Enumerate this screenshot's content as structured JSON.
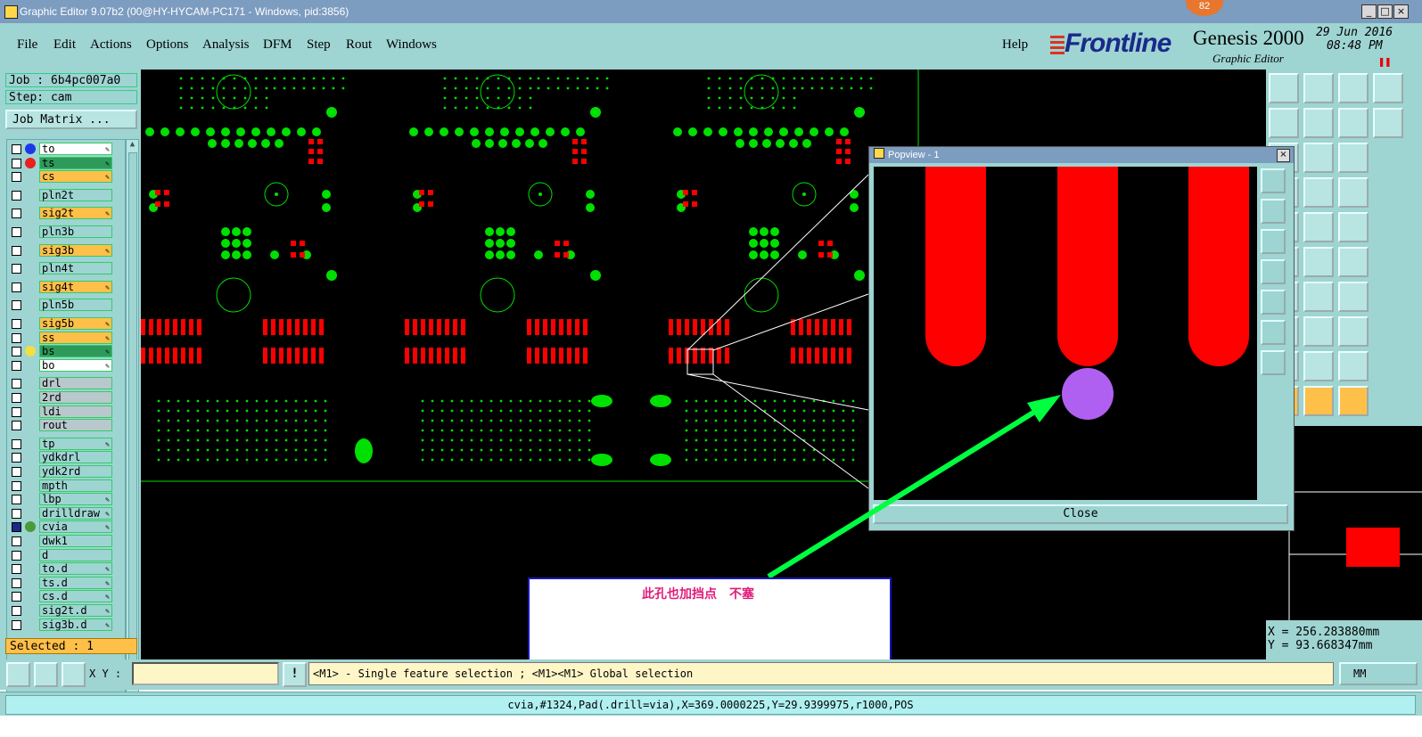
{
  "window": {
    "title": "Graphic Editor 9.07b2 (00@HY-HYCAM-PC171 - Windows, pid:3856)",
    "notification_count": "82",
    "minimize": "_",
    "maximize": "□",
    "close": "×"
  },
  "menu": {
    "items": [
      "File",
      "Edit",
      "Actions",
      "Options",
      "Analysis",
      "DFM",
      "Step",
      "Rout",
      "Windows"
    ],
    "help": "Help"
  },
  "brand": {
    "logo": "Frontline",
    "product": "Genesis 2000",
    "subtitle": "Graphic Editor",
    "date": "29 Jun 2016",
    "time": "08:48 PM"
  },
  "job": {
    "job_line": "Job : 6b4pc007a0",
    "step_line": "Step: cam",
    "matrix_button": "Job Matrix ..."
  },
  "layers": [
    {
      "name": "to",
      "bg": "#ffffff",
      "dot": "#1a3ae8",
      "edit": true
    },
    {
      "name": "ts",
      "bg": "#2e9a5a",
      "dot": "#e82020",
      "edit": true
    },
    {
      "name": "cs",
      "bg": "#ffc04a",
      "dot": "",
      "edit": true
    },
    {
      "name": "pln2t",
      "bg": "#9ed4d2",
      "dot": "",
      "edit": false
    },
    {
      "name": "sig2t",
      "bg": "#ffc04a",
      "dot": "",
      "edit": true
    },
    {
      "name": "pln3b",
      "bg": "#9ed4d2",
      "dot": "",
      "edit": false
    },
    {
      "name": "sig3b",
      "bg": "#ffc04a",
      "dot": "",
      "edit": true
    },
    {
      "name": "pln4t",
      "bg": "#9ed4d2",
      "dot": "",
      "edit": false
    },
    {
      "name": "sig4t",
      "bg": "#ffc04a",
      "dot": "",
      "edit": true
    },
    {
      "name": "pln5b",
      "bg": "#9ed4d2",
      "dot": "",
      "edit": false
    },
    {
      "name": "sig5b",
      "bg": "#ffc04a",
      "dot": "",
      "edit": true
    },
    {
      "name": "ss",
      "bg": "#ffc04a",
      "dot": "",
      "edit": true
    },
    {
      "name": "bs",
      "bg": "#2e9a5a",
      "dot": "#f0e040",
      "edit": true
    },
    {
      "name": "bo",
      "bg": "#ffffff",
      "dot": "",
      "edit": true
    },
    {
      "name": "drl",
      "bg": "#b8c8cc",
      "dot": "",
      "edit": false
    },
    {
      "name": "2rd",
      "bg": "#b8c8cc",
      "dot": "",
      "edit": false
    },
    {
      "name": "ldi",
      "bg": "#b8c8cc",
      "dot": "",
      "edit": false
    },
    {
      "name": "rout",
      "bg": "#b8c8cc",
      "dot": "",
      "edit": false
    },
    {
      "name": "tp",
      "bg": "#9ed4d2",
      "dot": "",
      "edit": true
    },
    {
      "name": "ydkdrl",
      "bg": "#9ed4d2",
      "dot": "",
      "edit": false
    },
    {
      "name": "ydk2rd",
      "bg": "#9ed4d2",
      "dot": "",
      "edit": false
    },
    {
      "name": "mpth",
      "bg": "#9ed4d2",
      "dot": "",
      "edit": false
    },
    {
      "name": "lbp",
      "bg": "#9ed4d2",
      "dot": "",
      "edit": true
    },
    {
      "name": "drilldraw",
      "bg": "#9ed4d2",
      "dot": "",
      "edit": true
    },
    {
      "name": "cvia",
      "bg": "#9ed4d2",
      "dot": "#4a9a3a",
      "edit": true
    },
    {
      "name": "dwk1",
      "bg": "#9ed4d2",
      "dot": "",
      "edit": false
    },
    {
      "name": "d",
      "bg": "#9ed4d2",
      "dot": "",
      "edit": false
    },
    {
      "name": "to.d",
      "bg": "#9ed4d2",
      "dot": "",
      "edit": true
    },
    {
      "name": "ts.d",
      "bg": "#9ed4d2",
      "dot": "",
      "edit": true
    },
    {
      "name": "cs.d",
      "bg": "#9ed4d2",
      "dot": "",
      "edit": true
    },
    {
      "name": "sig2t.d",
      "bg": "#9ed4d2",
      "dot": "",
      "edit": true
    },
    {
      "name": "sig3b.d",
      "bg": "#9ed4d2",
      "dot": "",
      "edit": true
    }
  ],
  "selected": "Selected : 1",
  "popview": {
    "title": "Popview - 1",
    "close_button": "Close",
    "close_x": "×"
  },
  "annotation": {
    "text": "此孔也加挡点　不塞"
  },
  "coords": {
    "x": "X = 256.283880mm",
    "y": "Y = 93.668347mm"
  },
  "bottom": {
    "xy_label": "X Y :",
    "xy_value": "",
    "message": "<M1> - Single feature selection ; <M1><M1> Global selection",
    "units": "MM",
    "bang": "!"
  },
  "status": "cvia,#1324,Pad(.drill=via),X=369.0000225,Y=29.9399975,r1000,POS",
  "colors": {
    "panel": "#9ed4d2",
    "copper_red": "#ff0000",
    "green": "#00e000",
    "via_purple": "#b060f0",
    "annotation_text": "#e01a7a",
    "annotation_border": "#1a18b8"
  }
}
